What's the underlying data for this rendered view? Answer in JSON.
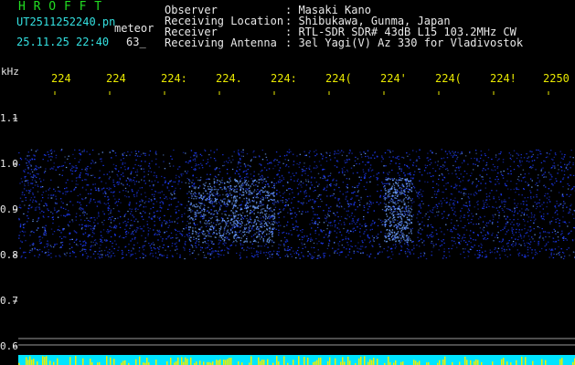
{
  "header": {
    "title": "H R O F F T",
    "filename": "UT2511252240.pn",
    "file_type": "meteor",
    "datetime": "25.11.25 22:40",
    "count": "63_"
  },
  "station_info": {
    "rows": [
      {
        "label": "Observer",
        "value": ": Masaki Kano"
      },
      {
        "label": "Receiving Location",
        "value": ": Shibukawa, Gunma, Japan"
      },
      {
        "label": "Receiver",
        "value": ": RTL-SDR SDR# 43dB L15 103.2MHz CW"
      },
      {
        "label": "Receiving Antenna",
        "value": ": 3el Yagi(V) Az 330 for Vladivostok"
      }
    ]
  },
  "spectrogram": {
    "unit_label": "kHz",
    "time_ticks": [
      "224",
      "224",
      "224:",
      "224.",
      "224:",
      "224(",
      "224'",
      "224(",
      "224!",
      "2250"
    ],
    "freq_ticks": [
      "1.1",
      "1.0",
      "0.9",
      "0.8",
      "0.7",
      "0.6"
    ],
    "colors": {
      "background": "#000000",
      "signal": "#1e3cff",
      "signal_bright": "#6ea0ff",
      "tick_labels_time": "#e8e800",
      "tick_labels_freq": "#e8e8e8",
      "bottom_band_cyan": "#00e5ff",
      "bottom_band_yellow": "#f0f000"
    }
  }
}
